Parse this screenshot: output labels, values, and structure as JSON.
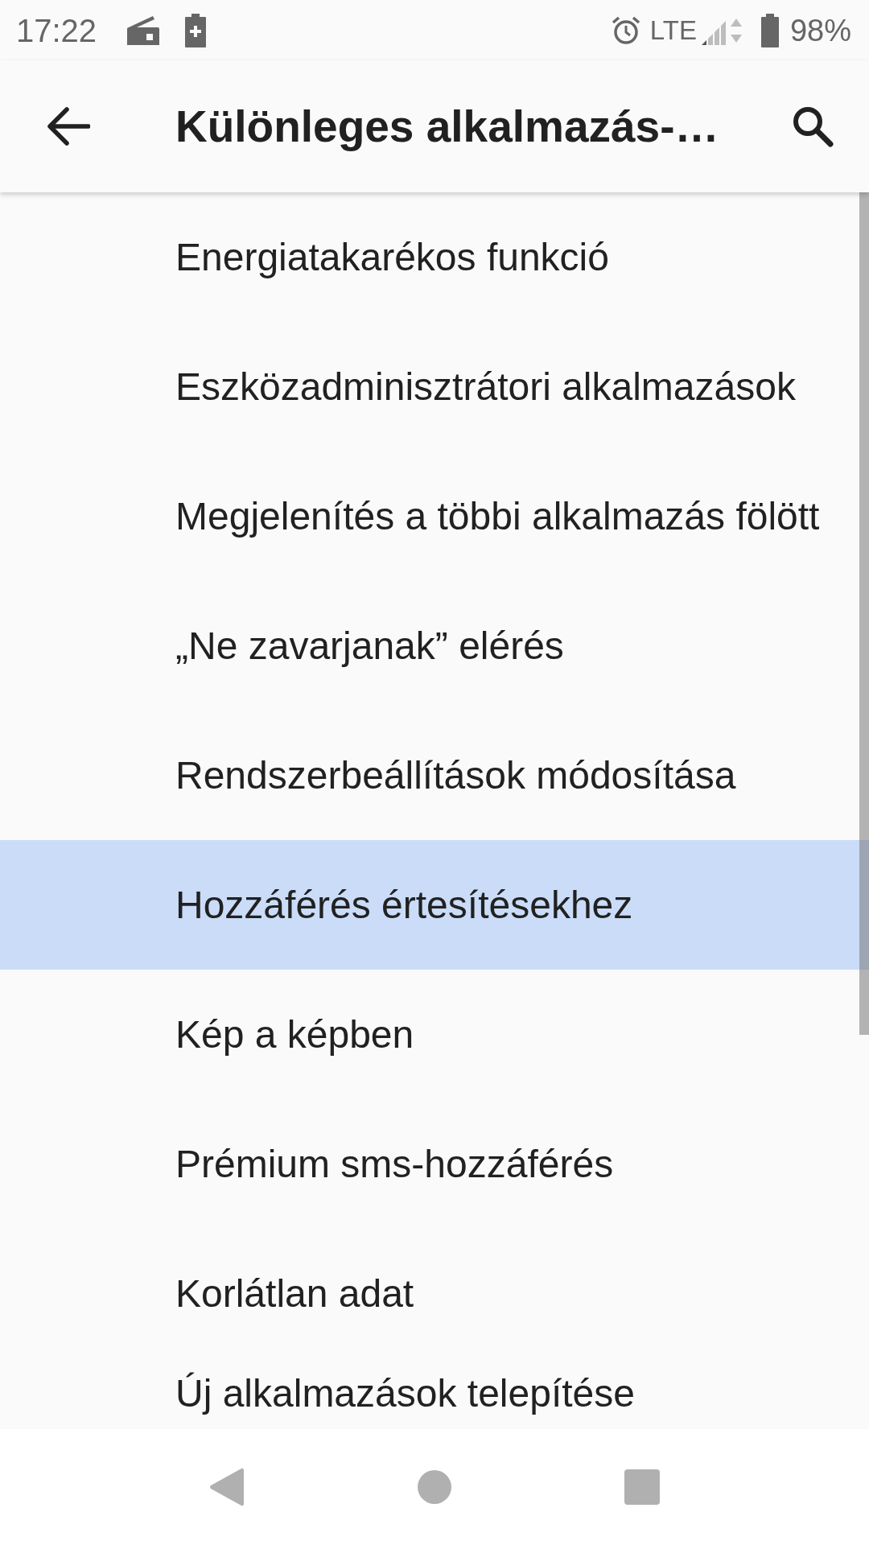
{
  "status_bar": {
    "time": "17:22",
    "network": "LTE",
    "battery": "98%"
  },
  "app_bar": {
    "title": "Különleges alkalmazás-…"
  },
  "items": [
    {
      "label": "Energiatakarékos funkció",
      "selected": false
    },
    {
      "label": "Eszközadminisztrátori alkalmazások",
      "selected": false
    },
    {
      "label": "Megjelenítés a többi alkalmazás fölött",
      "selected": false
    },
    {
      "label": "„Ne zavarjanak” elérés",
      "selected": false
    },
    {
      "label": "Rendszerbeállítások módosítása",
      "selected": false
    },
    {
      "label": "Hozzáférés értesítésekhez",
      "selected": true
    },
    {
      "label": "Kép a képben",
      "selected": false
    },
    {
      "label": "Prémium sms-hozzáférés",
      "selected": false
    },
    {
      "label": "Korlátlan adat",
      "selected": false
    },
    {
      "label": "Új alkalmazások telepítése",
      "selected": false
    }
  ]
}
